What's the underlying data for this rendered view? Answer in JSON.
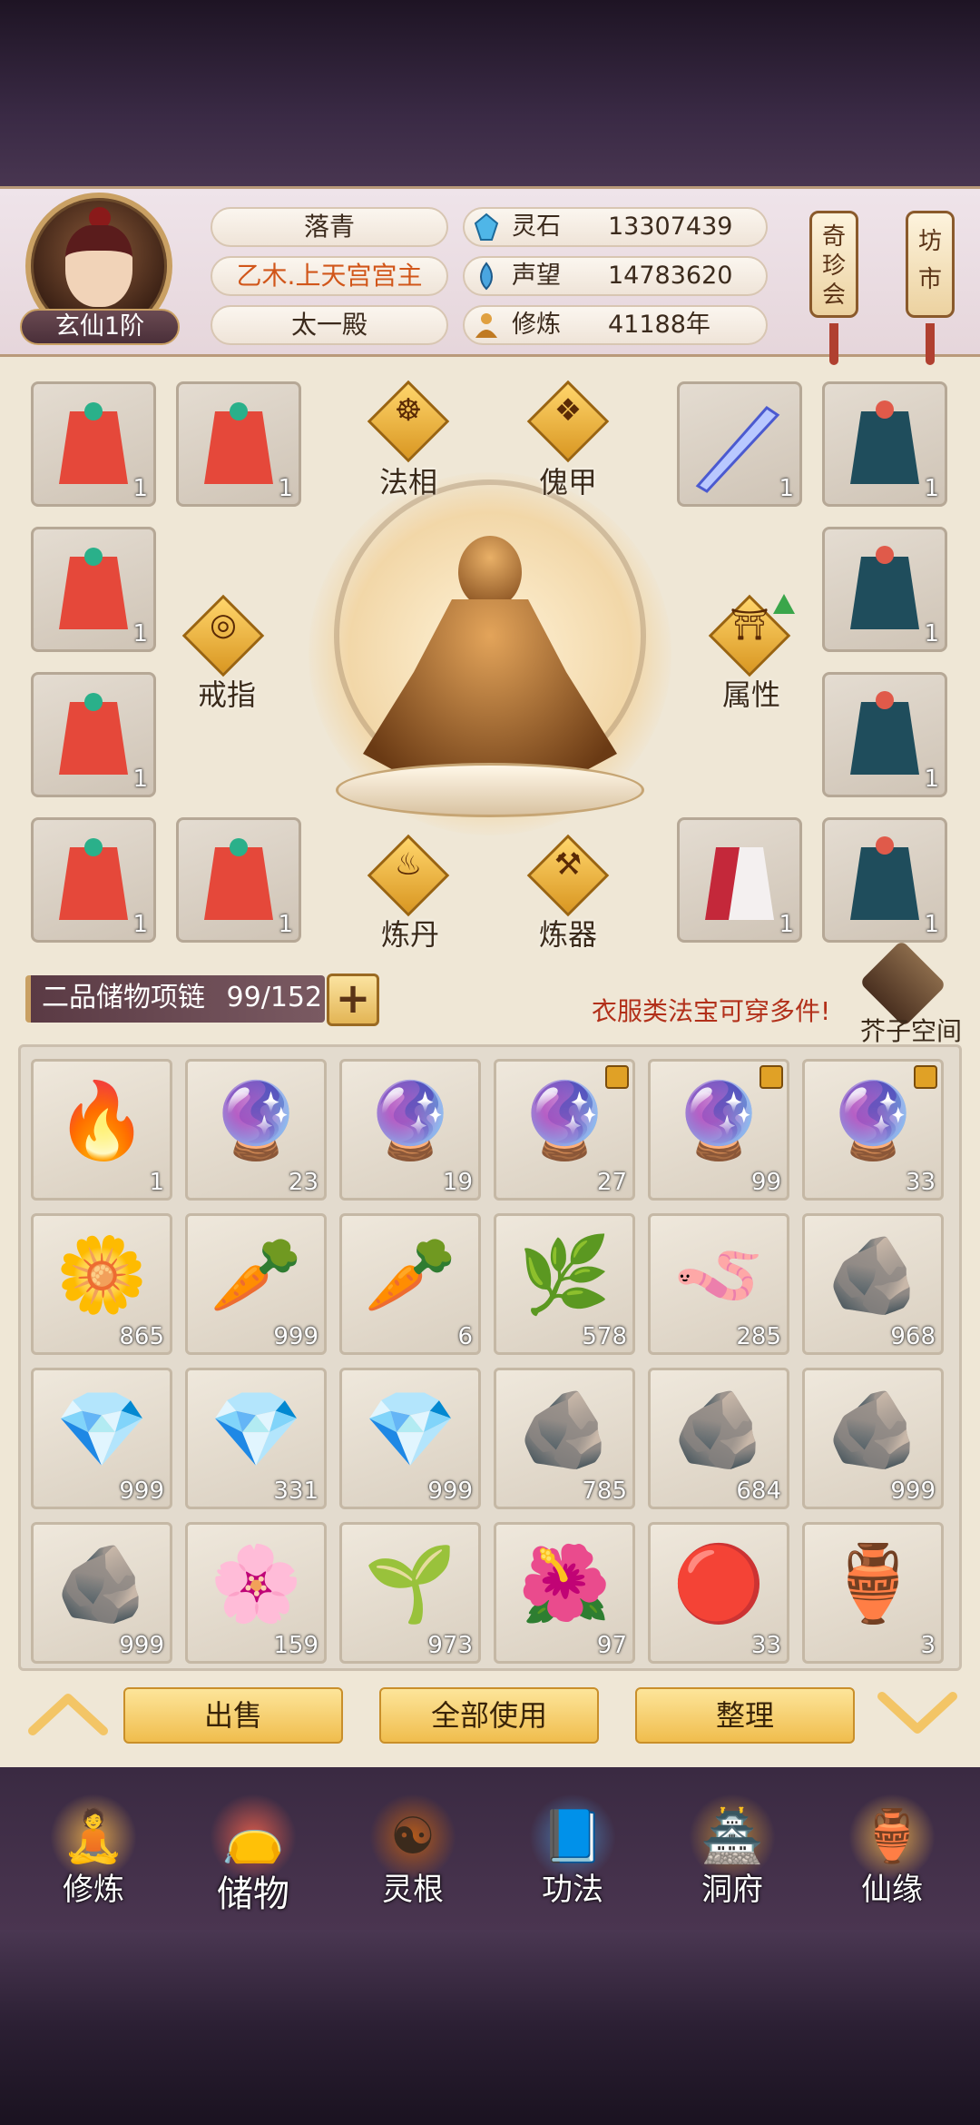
{
  "player": {
    "rank": "玄仙1阶",
    "name": "落青",
    "title": "乙木.上天宫宫主",
    "faction": "太一殿"
  },
  "stats": [
    {
      "label": "灵石",
      "value": "13307439",
      "icon": "spirit-stone-icon"
    },
    {
      "label": "声望",
      "value": "14783620",
      "icon": "prestige-icon"
    },
    {
      "label": "修炼",
      "value": "41188年",
      "icon": "cultivation-icon"
    }
  ],
  "side_buttons": [
    "奇珍会",
    "坊市"
  ],
  "slots": {
    "fa_xiang": "法相",
    "kui_jia": "傀甲",
    "ring": "戒指",
    "attribute": "属性",
    "alchemy": "炼丹",
    "forging": "炼器"
  },
  "equipment": [
    {
      "name": "red-robe",
      "count": "1"
    },
    {
      "name": "red-robe",
      "count": "1"
    },
    {
      "name": "blade-weapon",
      "count": "1"
    },
    {
      "name": "teal-robe",
      "count": "1"
    },
    {
      "name": "red-robe",
      "count": "1"
    },
    {
      "name": "teal-robe",
      "count": "1"
    },
    {
      "name": "red-robe",
      "count": "1"
    },
    {
      "name": "teal-robe",
      "count": "1"
    },
    {
      "name": "red-robe",
      "count": "1"
    },
    {
      "name": "red-robe",
      "count": "1"
    },
    {
      "name": "white-red-robe",
      "count": "1"
    },
    {
      "name": "teal-robe",
      "count": "1"
    }
  ],
  "storage": {
    "chain_label": "二品储物项链",
    "capacity": "99/152",
    "hint": "衣服类法宝可穿多件!",
    "mustard_space": "芥子空间"
  },
  "items": [
    {
      "name": "red-flame-essence",
      "count": "1",
      "glyph": "🔥",
      "locked": false
    },
    {
      "name": "purple-flame-essence",
      "count": "23",
      "glyph": "🔮",
      "locked": false
    },
    {
      "name": "purple-flame-essence",
      "count": "19",
      "glyph": "🔮",
      "locked": false
    },
    {
      "name": "purple-orb",
      "count": "27",
      "glyph": "🔮",
      "locked": true
    },
    {
      "name": "purple-orb",
      "count": "99",
      "glyph": "🔮",
      "locked": true
    },
    {
      "name": "purple-orb",
      "count": "33",
      "glyph": "🔮",
      "locked": true
    },
    {
      "name": "white-lily",
      "count": "865",
      "glyph": "🌼",
      "locked": false
    },
    {
      "name": "ginseng",
      "count": "999",
      "glyph": "🥕",
      "locked": false
    },
    {
      "name": "ginseng",
      "count": "6",
      "glyph": "🥕",
      "locked": false
    },
    {
      "name": "root-herb",
      "count": "578",
      "glyph": "🌿",
      "locked": false
    },
    {
      "name": "cordyceps",
      "count": "285",
      "glyph": "🪱",
      "locked": false
    },
    {
      "name": "fire-ore",
      "count": "968",
      "glyph": "🪨",
      "locked": false
    },
    {
      "name": "cyan-crystal",
      "count": "999",
      "glyph": "💎",
      "locked": false
    },
    {
      "name": "green-crystal",
      "count": "331",
      "glyph": "💎",
      "locked": false
    },
    {
      "name": "green-crystal",
      "count": "999",
      "glyph": "💎",
      "locked": false
    },
    {
      "name": "dark-ore",
      "count": "785",
      "glyph": "🪨",
      "locked": false
    },
    {
      "name": "iron-ore",
      "count": "684",
      "glyph": "🪨",
      "locked": false
    },
    {
      "name": "silver-ore",
      "count": "999",
      "glyph": "🪨",
      "locked": false
    },
    {
      "name": "silver-ore",
      "count": "999",
      "glyph": "🪨",
      "locked": false
    },
    {
      "name": "pink-flower",
      "count": "159",
      "glyph": "🌸",
      "locked": false
    },
    {
      "name": "green-herb",
      "count": "973",
      "glyph": "🌱",
      "locked": false
    },
    {
      "name": "plum-branch",
      "count": "97",
      "glyph": "🌺",
      "locked": false
    },
    {
      "name": "red-pearl",
      "count": "33",
      "glyph": "🔴",
      "locked": false
    },
    {
      "name": "gourd",
      "count": "3",
      "glyph": "🏺",
      "locked": false
    }
  ],
  "actions": {
    "sell": "出售",
    "use_all": "全部使用",
    "sort": "整理"
  },
  "nav": [
    {
      "label": "修炼",
      "icon": "monk-icon",
      "glyph": "🧘",
      "color": "#d9a04a"
    },
    {
      "label": "储物",
      "icon": "bag-icon",
      "glyph": "👝",
      "color": "#d65a4a"
    },
    {
      "label": "灵根",
      "icon": "spirit-root-icon",
      "glyph": "☯",
      "color": "#b35a1a"
    },
    {
      "label": "功法",
      "icon": "scroll-book-icon",
      "glyph": "📘",
      "color": "#4a7ab0"
    },
    {
      "label": "洞府",
      "icon": "palace-icon",
      "glyph": "🏯",
      "color": "#b4823a"
    },
    {
      "label": "仙缘",
      "icon": "gourd-icon",
      "glyph": "🏺",
      "color": "#d9a04a"
    }
  ],
  "colors": {
    "accent_gold": "#e8b54f",
    "hint_red": "#b2301a",
    "title_orange": "#d1561a"
  }
}
